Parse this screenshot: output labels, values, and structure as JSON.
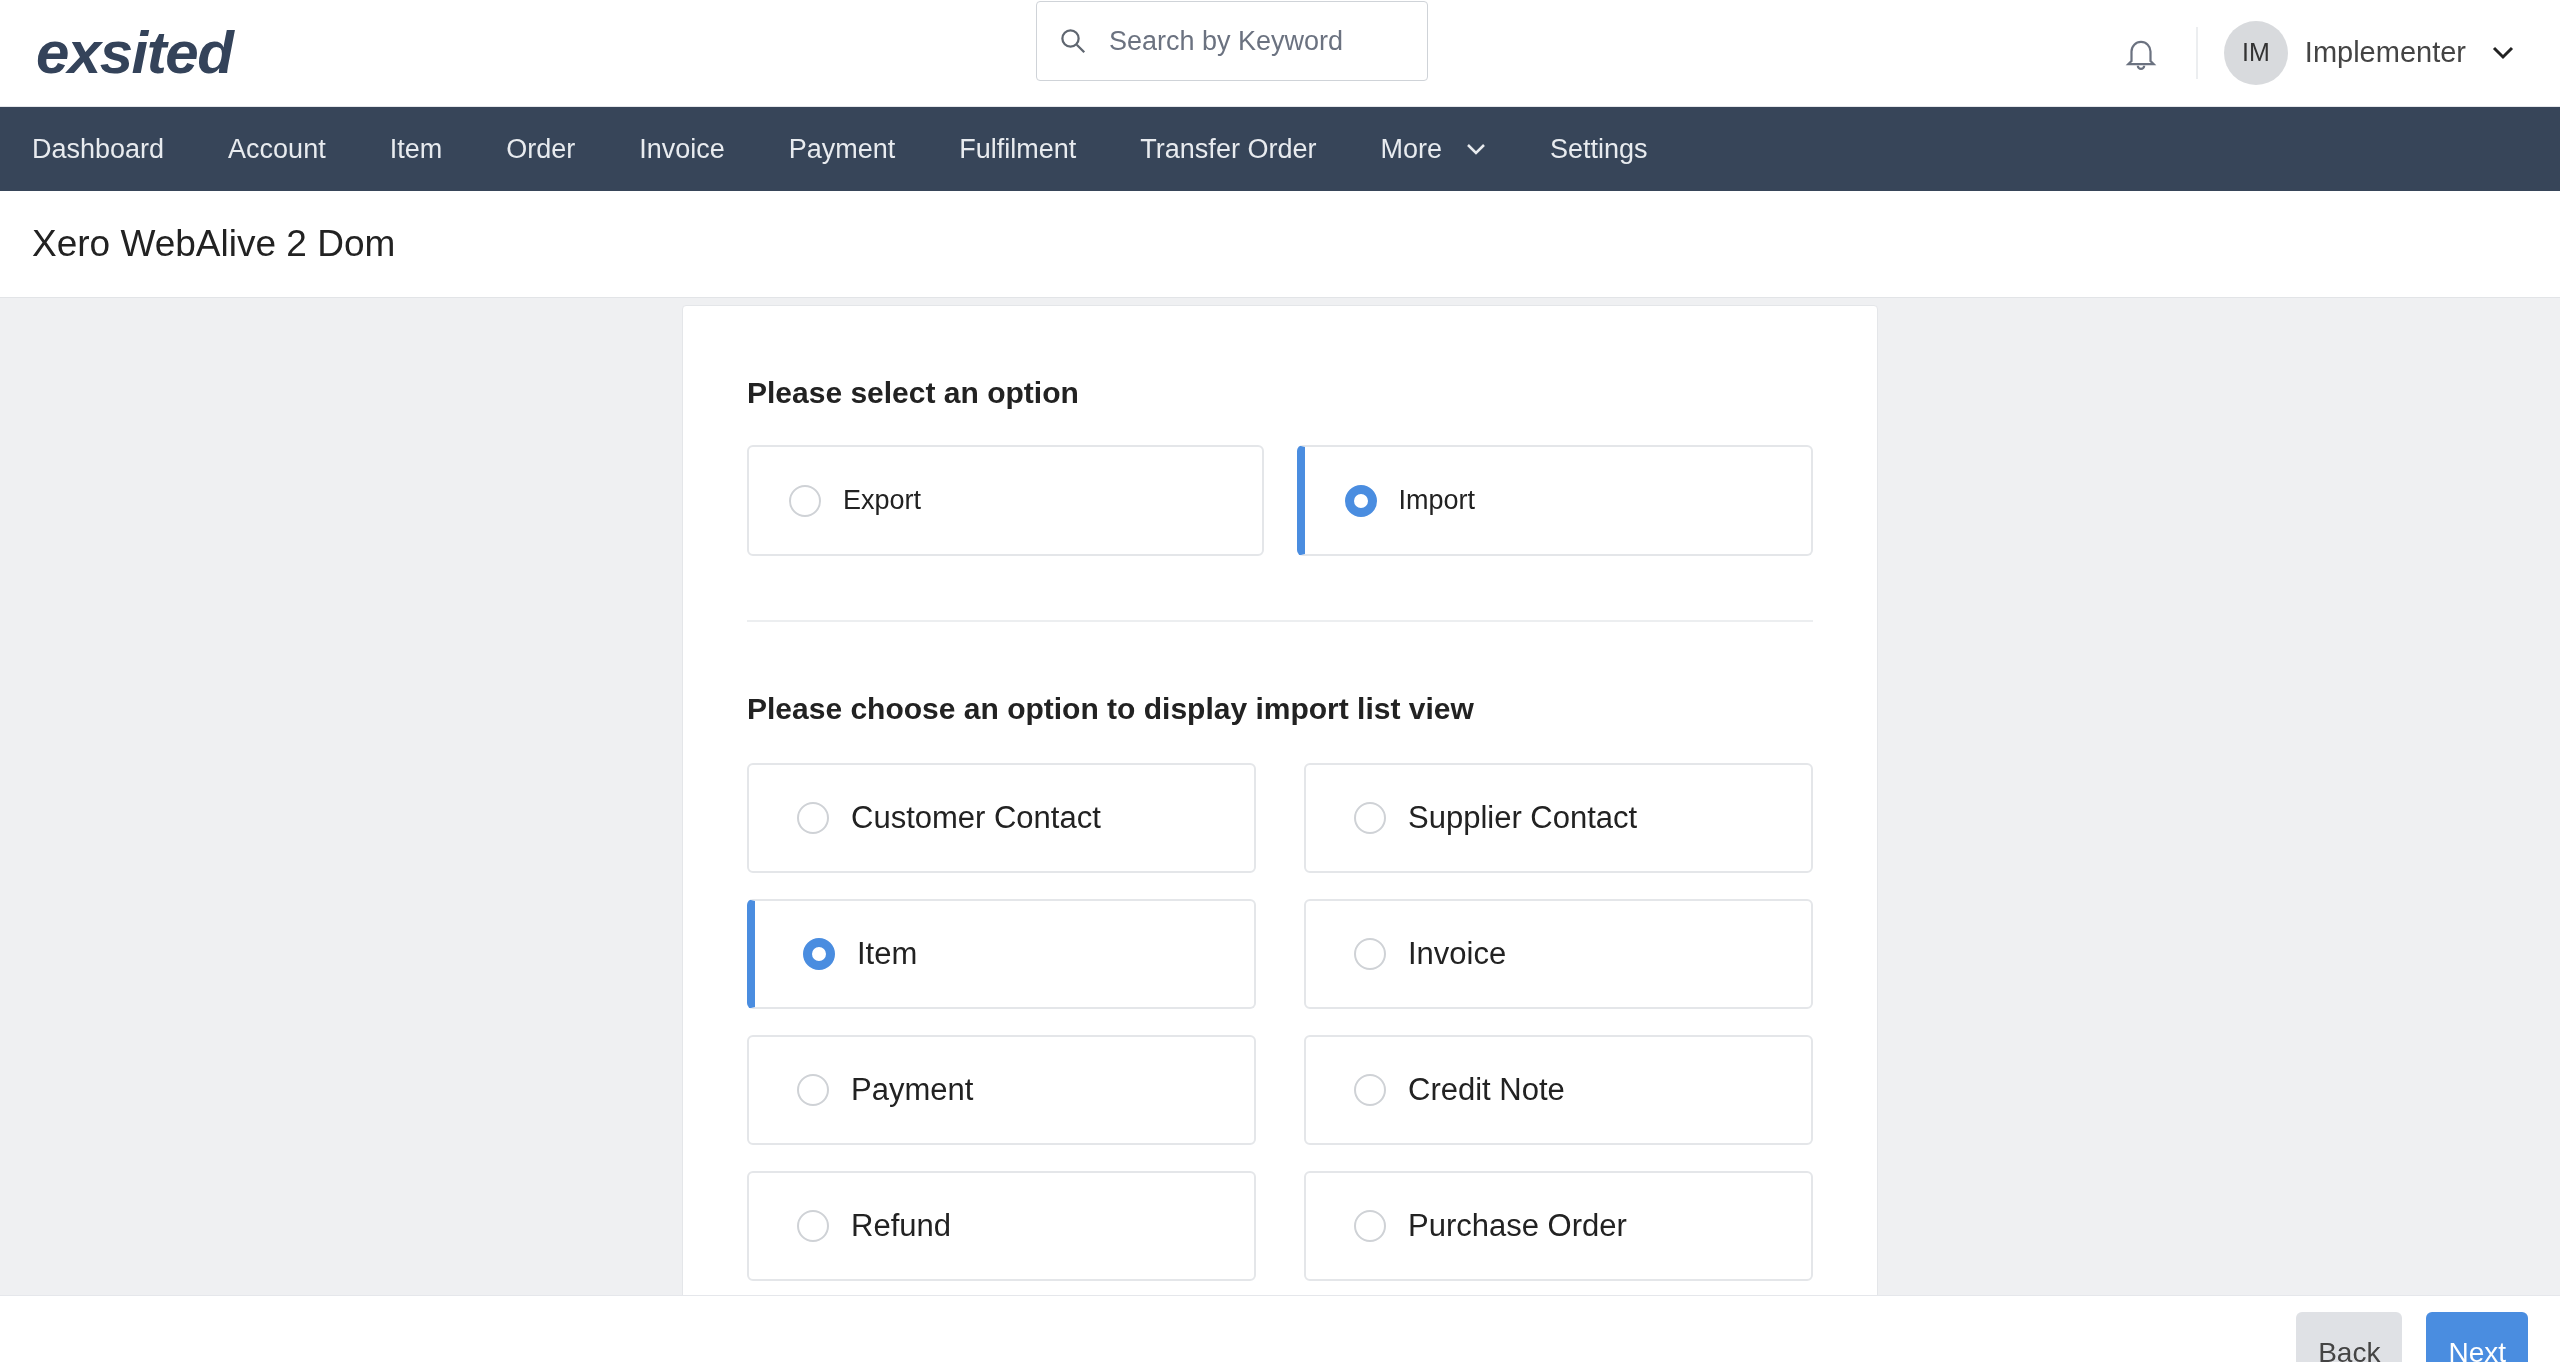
{
  "logo": {
    "text": "exsited"
  },
  "search": {
    "placeholder": "Search by Keyword"
  },
  "user": {
    "initials": "IM",
    "name": "Implementer"
  },
  "nav": [
    {
      "label": "Dashboard",
      "dropdown": false
    },
    {
      "label": "Account",
      "dropdown": false
    },
    {
      "label": "Item",
      "dropdown": false
    },
    {
      "label": "Order",
      "dropdown": false
    },
    {
      "label": "Invoice",
      "dropdown": false
    },
    {
      "label": "Payment",
      "dropdown": false
    },
    {
      "label": "Fulfilment",
      "dropdown": false
    },
    {
      "label": "Transfer Order",
      "dropdown": false
    },
    {
      "label": "More",
      "dropdown": true
    },
    {
      "label": "Settings",
      "dropdown": false
    }
  ],
  "page_title": "Xero WebAlive 2 Dom",
  "mode_section": {
    "heading": "Please select an option",
    "options": [
      {
        "label": "Export",
        "selected": false
      },
      {
        "label": "Import",
        "selected": true
      }
    ]
  },
  "list_section": {
    "heading": "Please choose an option to display import list view",
    "options": [
      {
        "label": "Customer Contact",
        "selected": false
      },
      {
        "label": "Supplier Contact",
        "selected": false
      },
      {
        "label": "Item",
        "selected": true
      },
      {
        "label": "Invoice",
        "selected": false
      },
      {
        "label": "Payment",
        "selected": false
      },
      {
        "label": "Credit Note",
        "selected": false
      },
      {
        "label": "Refund",
        "selected": false
      },
      {
        "label": "Purchase Order",
        "selected": false
      }
    ]
  },
  "footer": {
    "buttons": [
      {
        "label": "Back",
        "kind": "secondary"
      },
      {
        "label": "Next",
        "kind": "primary"
      }
    ]
  }
}
